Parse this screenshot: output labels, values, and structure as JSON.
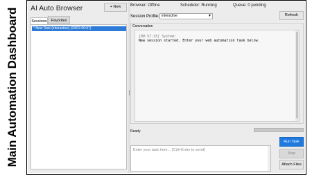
{
  "banner": {
    "text": "Main Automation Dashboard"
  },
  "app": {
    "title": "AI Auto Browser",
    "new_button": "+ New",
    "tabs": [
      {
        "label": "Sessions"
      },
      {
        "label": "Favorites"
      }
    ],
    "sessions": [
      {
        "label": "* New Task (interactive) (03/03 00:57)",
        "selected": true
      }
    ]
  },
  "status_bar": {
    "browser": "Browser: Offline",
    "scheduler": "Scheduler: Running",
    "queue": "Queue: 0 pending"
  },
  "profile": {
    "label": "Session Profile:",
    "value": "interactive"
  },
  "refresh_button": "Refresh",
  "conversation": {
    "label": "Conversation",
    "messages": [
      {
        "meta": "[00:57:15] System:",
        "text": "New session started. Enter your web automation task below."
      }
    ]
  },
  "status": {
    "text": "Ready"
  },
  "input": {
    "placeholder": "Enter your task here... (Ctrl+Enter to send)"
  },
  "actions": {
    "run": "Run Task",
    "stop": "Stop",
    "attach": "Attach Files"
  },
  "colors": {
    "accent": "#1f7ae0",
    "selection": "#2d7bd6"
  }
}
